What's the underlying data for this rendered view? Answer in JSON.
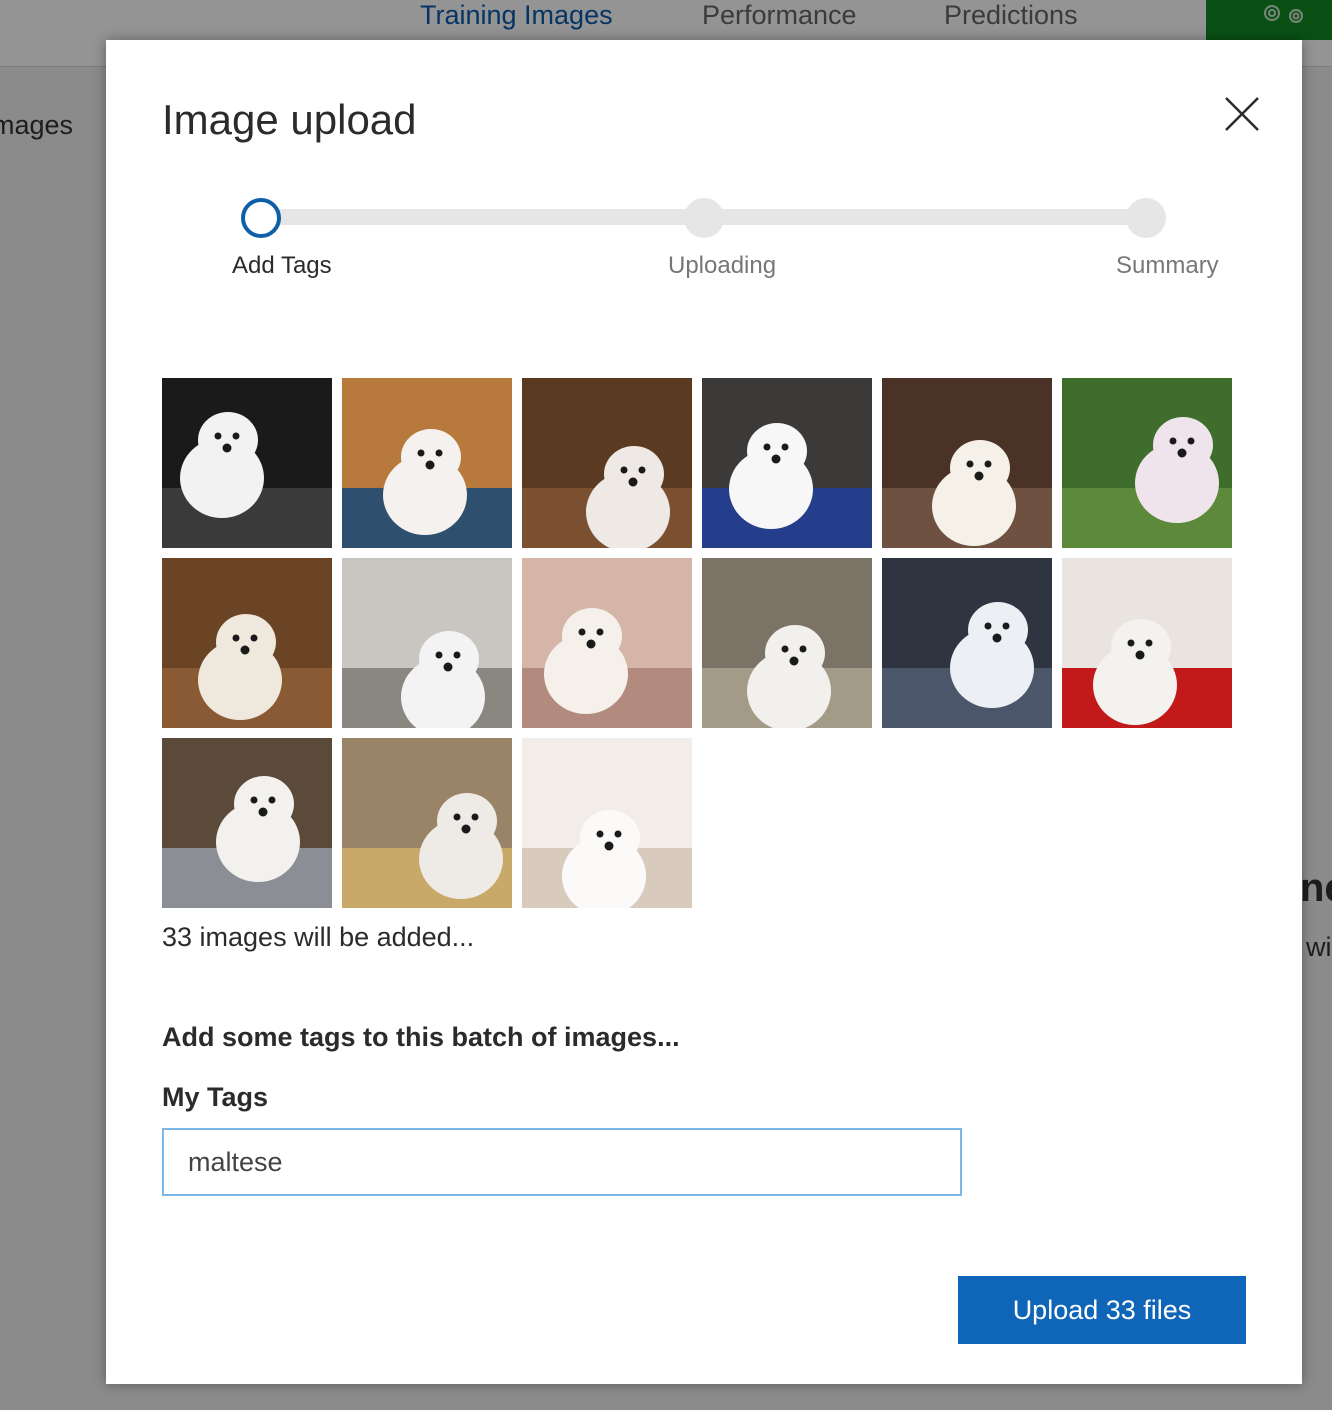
{
  "background": {
    "tabs": [
      {
        "label": "Training Images",
        "active": true
      },
      {
        "label": "Performance",
        "active": false
      },
      {
        "label": "Predictions",
        "active": false
      }
    ],
    "left_text": "mages",
    "right_text_1": "ne",
    "right_text_2": "wi",
    "settings_icon": "gear-icon"
  },
  "dialog": {
    "title": "Image upload",
    "close_icon": "close-icon",
    "steps": [
      {
        "label": "Add Tags",
        "state": "active"
      },
      {
        "label": "Uploading",
        "state": "pending"
      },
      {
        "label": "Summary",
        "state": "pending"
      }
    ],
    "thumbnails": [
      {
        "alt": "maltese-photo-1"
      },
      {
        "alt": "maltese-photo-2"
      },
      {
        "alt": "maltese-photo-3"
      },
      {
        "alt": "maltese-photo-4"
      },
      {
        "alt": "maltese-photo-5"
      },
      {
        "alt": "maltese-photo-6"
      },
      {
        "alt": "maltese-photo-7"
      },
      {
        "alt": "maltese-photo-8"
      },
      {
        "alt": "maltese-photo-9"
      },
      {
        "alt": "maltese-photo-10"
      },
      {
        "alt": "maltese-photo-11"
      },
      {
        "alt": "maltese-photo-12"
      },
      {
        "alt": "maltese-photo-13"
      },
      {
        "alt": "maltese-photo-14"
      },
      {
        "alt": "maltese-photo-15"
      }
    ],
    "count_text": "33 images will be added...",
    "prompt_text": "Add some tags to this batch of images...",
    "tags_label": "My Tags",
    "tags_value": "maltese",
    "upload_label": "Upload 33 files"
  },
  "colors": {
    "accent": "#0f66b8",
    "step_active": "#0f5ea8",
    "input_focus": "#7ab8ea",
    "settings_bar": "#128a23"
  }
}
